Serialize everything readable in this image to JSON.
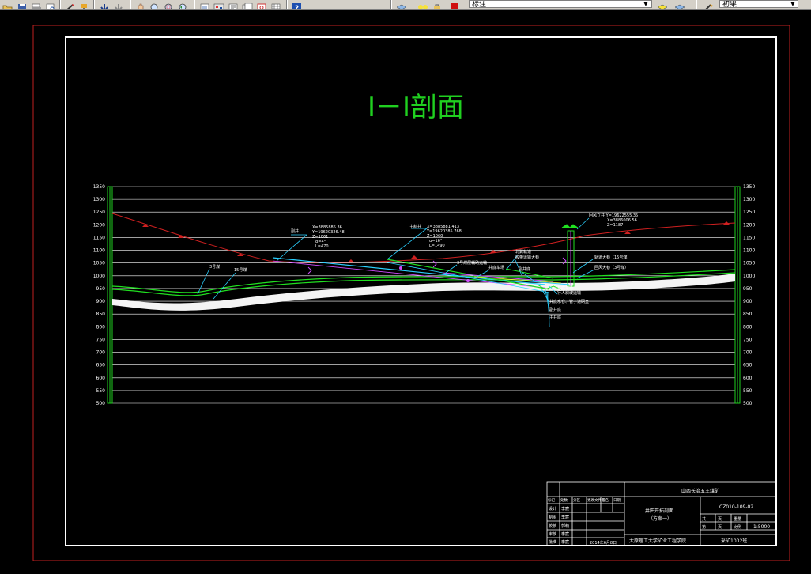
{
  "toolbar": {
    "items": [
      "open-icon",
      "save-icon",
      "print-icon",
      "preview-icon",
      "match-icon",
      "paint-icon",
      "undo-icon",
      "redo-icon",
      "pan-icon",
      "zoom-realtime-icon",
      "zoom-window-icon",
      "zoom-previous-icon",
      "properties-icon",
      "design-center-icon",
      "tool-palette-icon",
      "sheet-set-icon",
      "markup-icon",
      "calculator-icon",
      "help-icon"
    ],
    "layer_value": "标注",
    "style_value": "初果"
  },
  "drawing": {
    "title": "Ⅰ－Ⅰ剖面",
    "elevation_labels": [
      "1350",
      "1300",
      "1250",
      "1200",
      "1150",
      "1100",
      "1050",
      "1000",
      "950",
      "900",
      "850",
      "800",
      "750",
      "700",
      "650",
      "600",
      "550",
      "500"
    ],
    "annotations": [
      {
        "id": "a1",
        "text": "副井"
      },
      {
        "id": "a2",
        "text": "X=3885885.36"
      },
      {
        "id": "a3",
        "text": "Y=19620326.48"
      },
      {
        "id": "a4",
        "text": "Z=1061"
      },
      {
        "id": "a5",
        "text": "α=4°"
      },
      {
        "id": "a6",
        "text": "L=470"
      },
      {
        "id": "a7",
        "text": "主斜井"
      },
      {
        "id": "a8",
        "text": "X=3885881.413"
      },
      {
        "id": "a9",
        "text": "Y=19620385.768"
      },
      {
        "id": "a10",
        "text": "Z=1060"
      },
      {
        "id": "a11",
        "text": "α=16°"
      },
      {
        "id": "a12",
        "text": "L=1490"
      },
      {
        "id": "a13",
        "text": "回风立井 Y=19622555.35"
      },
      {
        "id": "a14",
        "text": "X=3886006.56"
      },
      {
        "id": "a15",
        "text": "Z=1187"
      },
      {
        "id": "a16",
        "text": "3号煤"
      },
      {
        "id": "a17",
        "text": "15号煤"
      },
      {
        "id": "a18",
        "text": "3号煤层辅助运输"
      },
      {
        "id": "a19",
        "text": "井底车场"
      },
      {
        "id": "a20",
        "text": "北翼轨道"
      },
      {
        "id": "a21",
        "text": "胶带运输大巷"
      },
      {
        "id": "a22",
        "text": "副井底"
      },
      {
        "id": "a23",
        "text": "轨道大巷（15号煤）"
      },
      {
        "id": "a24",
        "text": "回风大巷（3号煤）"
      },
      {
        "id": "a25",
        "text": "井底车场"
      },
      {
        "id": "a26",
        "text": "行人斜坡运输"
      },
      {
        "id": "a27",
        "text": "井底水仓、管子道硐室"
      },
      {
        "id": "a28",
        "text": "副井底"
      },
      {
        "id": "a29",
        "text": "主井底"
      }
    ],
    "title_block": {
      "company": "山西长治五王煤矿",
      "drawing_name_1": "井田开拓剖面",
      "drawing_name_2": "（方案一）",
      "drawing_no": "CZ010-109-02",
      "scale": "1:5000",
      "school": "太原理工大学矿业工程学院",
      "class_name": "采矿1002班",
      "date": "2014年6月8日",
      "header_cells": [
        "标记",
        "处数",
        "分区",
        "更改文件号",
        "签名",
        "日期"
      ],
      "sheet_labels": [
        "共",
        "页",
        "第",
        "页"
      ],
      "ratio_labels": [
        "重量",
        "比例"
      ],
      "sign_rows": [
        {
          "role": "设计",
          "name": "李宸"
        },
        {
          "role": "制图",
          "name": "李宸"
        },
        {
          "role": "校核",
          "name": "郭翰"
        },
        {
          "role": "审核",
          "name": "李宸"
        },
        {
          "role": "批准",
          "name": "李宸"
        }
      ]
    }
  }
}
